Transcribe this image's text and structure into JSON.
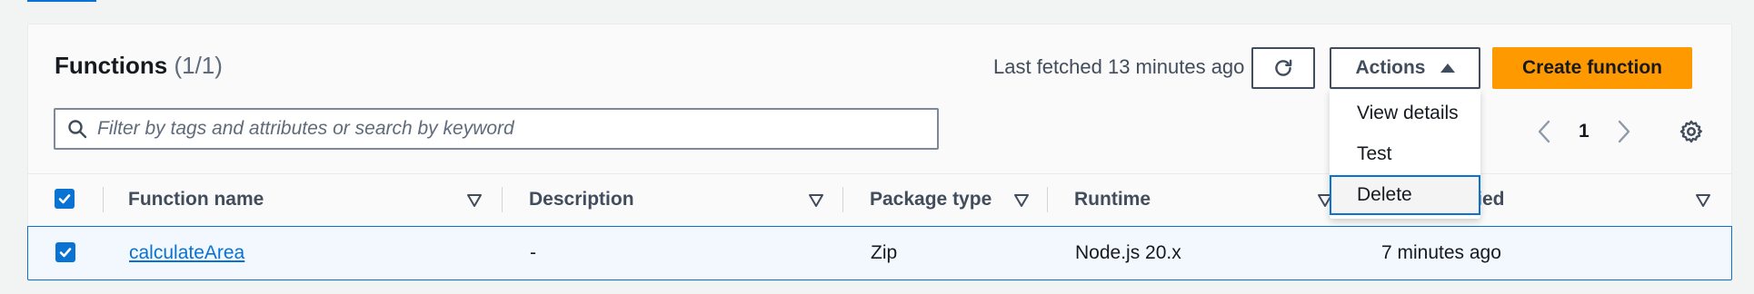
{
  "panel": {
    "title": "Functions",
    "count": "(1/1)",
    "last_fetched": "Last fetched 13 minutes ago"
  },
  "toolbar": {
    "refresh_icon": "refresh-icon",
    "actions_label": "Actions",
    "create_label": "Create function"
  },
  "search": {
    "placeholder": "Filter by tags and attributes or search by keyword"
  },
  "pagination": {
    "current_page": "1"
  },
  "actions_menu": {
    "items": [
      "View details",
      "Test",
      "Delete"
    ],
    "focused": "Delete"
  },
  "table": {
    "columns": [
      "Function name",
      "Description",
      "Package type",
      "Runtime",
      "Last modified"
    ],
    "rows": [
      {
        "selected": true,
        "function_name": "calculateArea",
        "description": "-",
        "package_type": "Zip",
        "runtime": "Node.js 20.x",
        "last_modified": "7 minutes ago"
      }
    ]
  },
  "colors": {
    "accent": "#0972d3",
    "primary_button": "#ff9900",
    "background": "#f2f3f3"
  }
}
